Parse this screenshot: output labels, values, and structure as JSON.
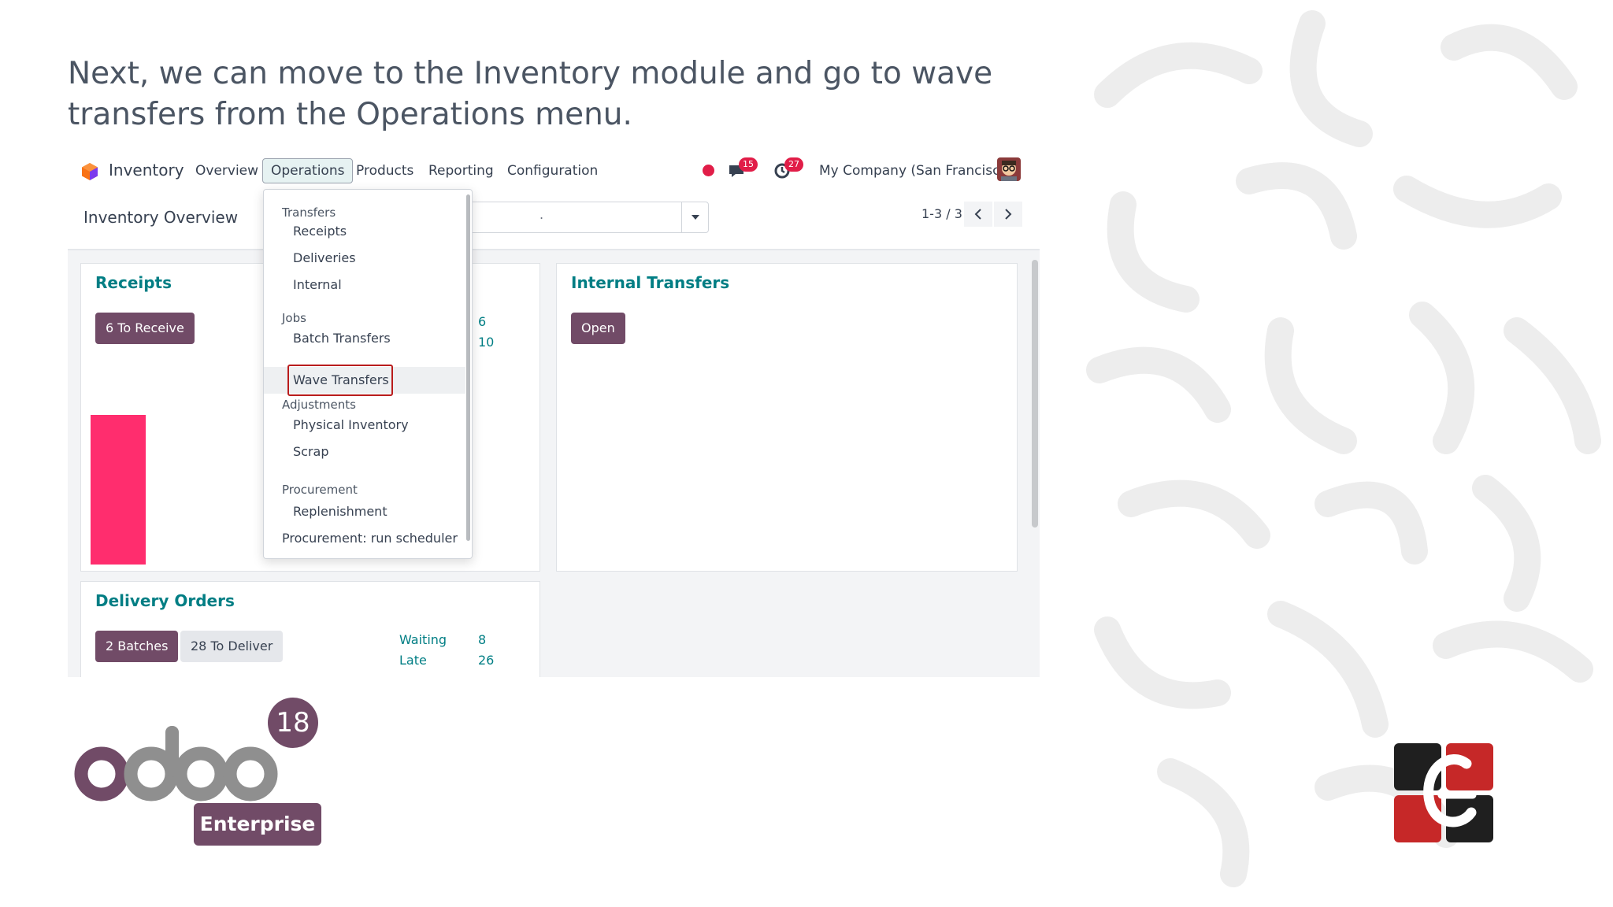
{
  "headline": "Next, we can move to the Inventory module and go to wave transfers from the Operations menu.",
  "navbar": {
    "app_name": "Inventory",
    "menus": [
      "Overview",
      "Operations",
      "Products",
      "Reporting",
      "Configuration"
    ],
    "active_menu": "Operations",
    "chat_count": "15",
    "activity_count": "27",
    "company": "My Company (San Francisco)"
  },
  "control": {
    "page_title": "Inventory Overview",
    "search_value": ".",
    "pager": "1-3 / 3"
  },
  "dropdown": {
    "sections": [
      {
        "header": "Transfers",
        "items": [
          "Receipts",
          "Deliveries",
          "Internal"
        ]
      },
      {
        "header": "Jobs",
        "items": [
          "Batch Transfers",
          "Wave Transfers"
        ]
      },
      {
        "header": "Adjustments",
        "items": [
          "Physical Inventory",
          "Scrap"
        ]
      },
      {
        "header": "Procurement",
        "items": [
          "Replenishment"
        ]
      }
    ],
    "last_item": "Procurement: run scheduler",
    "highlighted_item": "Wave Transfers"
  },
  "cards": {
    "receipts": {
      "title": "Receipts",
      "button": "6 To Receive",
      "stats": [
        "6",
        "10"
      ]
    },
    "internal": {
      "title": "Internal Transfers",
      "button": "Open"
    },
    "delivery": {
      "title": "Delivery Orders",
      "button_primary": "2 Batches",
      "button_secondary": "28 To Deliver",
      "stats": [
        {
          "label": "Waiting",
          "value": "8"
        },
        {
          "label": "Late",
          "value": "26"
        }
      ]
    }
  },
  "branding": {
    "product": "odoo",
    "version": "18",
    "edition": "Enterprise"
  },
  "colors": {
    "accent": "#714b67",
    "teal": "#017e84",
    "badge": "#e11d48",
    "bar": "#ff2d6e",
    "highlight": "#b91c1c"
  }
}
